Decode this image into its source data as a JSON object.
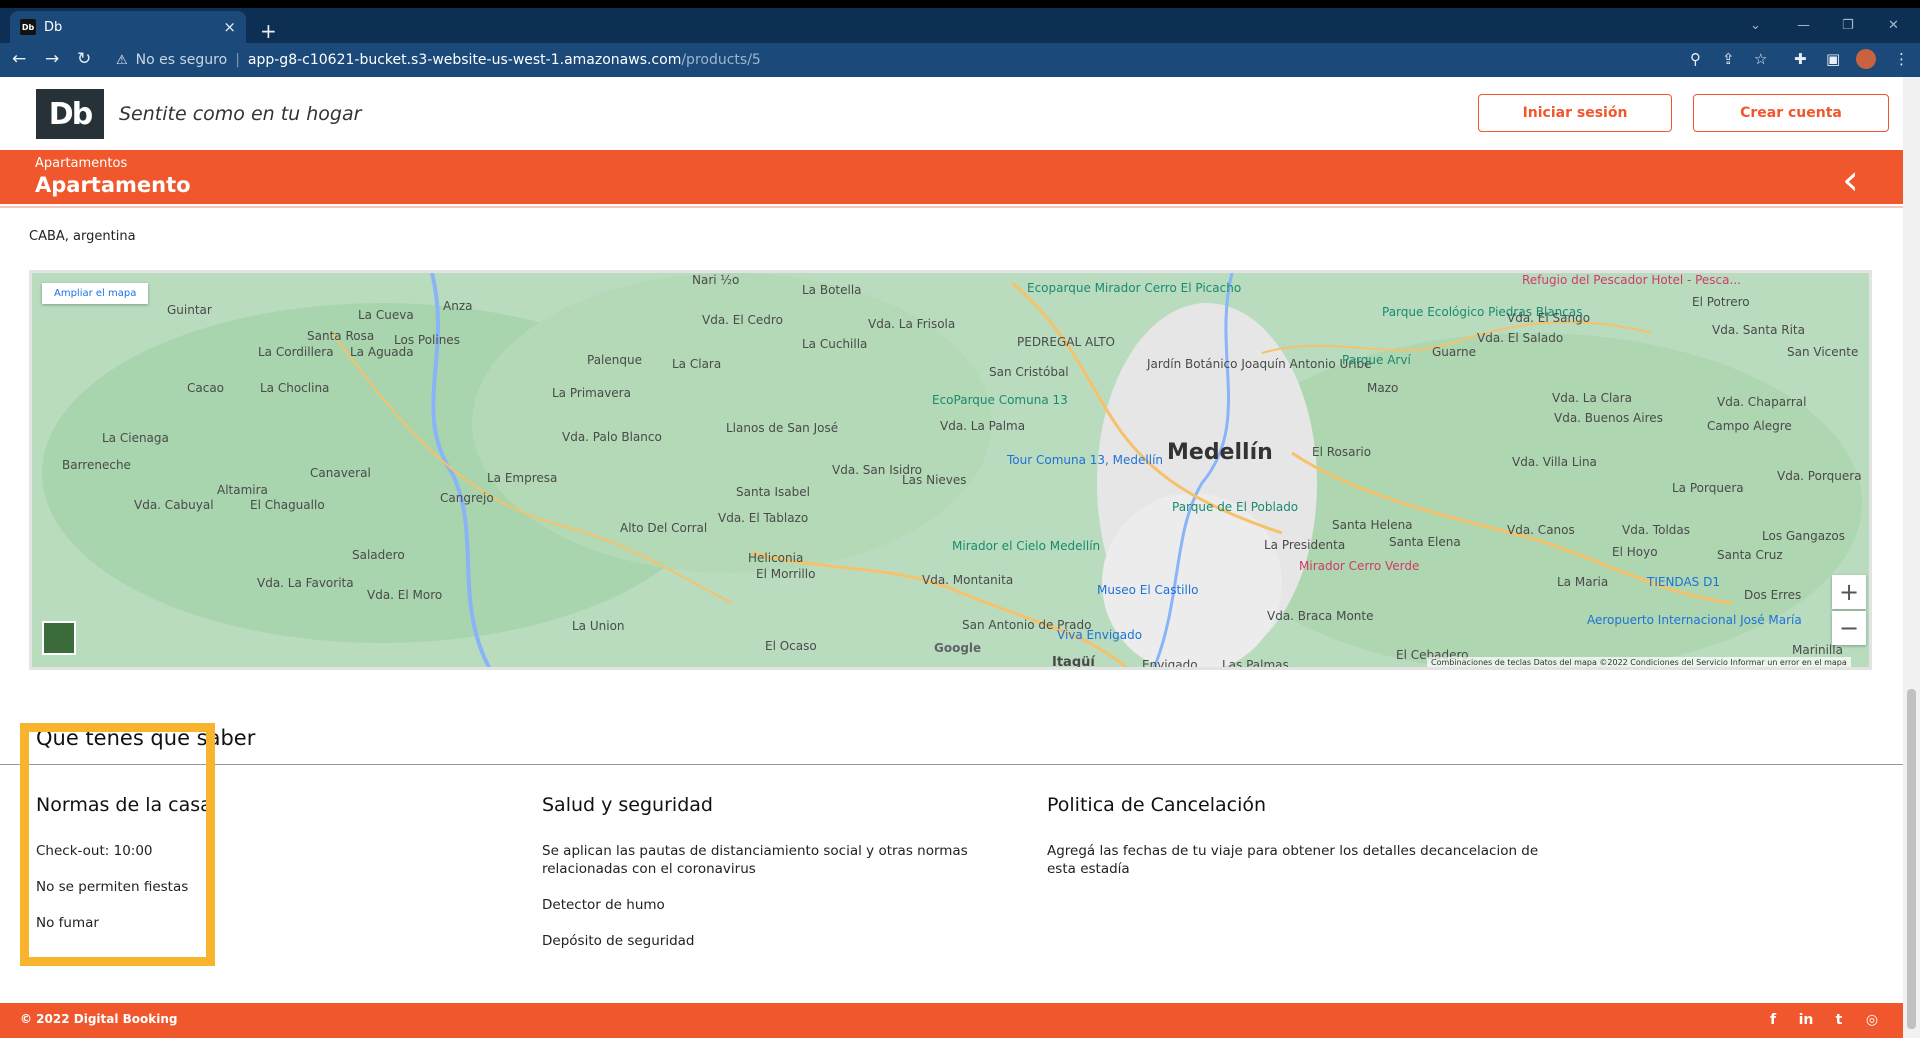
{
  "browser": {
    "tab_title": "Db",
    "tab_favicon": "Db",
    "close_glyph": "×",
    "newtab_glyph": "+",
    "security_label": "No es seguro",
    "url_host": "app-g8-c10621-bucket.s3-website-us-west-1.amazonaws.com",
    "url_path": "/products/5"
  },
  "header": {
    "logo": "Db",
    "tagline": "Sentite como en tu hogar",
    "login_label": "Iniciar sesión",
    "signup_label": "Crear cuenta"
  },
  "product": {
    "category": "Apartamentos",
    "name": "Apartamento",
    "back_glyph": "‹",
    "location": "CABA, argentina"
  },
  "map": {
    "enlarge_label": "Ampliar el mapa",
    "zoom_in": "+",
    "zoom_out": "−",
    "google": "Google",
    "footer": "Combinaciones de teclas   Datos del mapa ©2022   Condiciones del Servicio   Informar un error en el mapa",
    "labels": [
      "Guintar",
      "La Cueva",
      "Anza",
      "Santa Rosa",
      "Los Polines",
      "La Cordillera",
      "La Aguada",
      "Cacao",
      "La Choclina",
      "La Cienaga",
      "Barreneche",
      "Altamira",
      "Vda. Cabuyal",
      "El Chaguallo",
      "Canaveral",
      "Cangrejo",
      "Saladero",
      "Vda. La Favorita",
      "Vda. El Moro",
      "Nari ½o",
      "La Botella",
      "Vda. El Cedro",
      "Vda. La Frisola",
      "La Cuchilla",
      "Palenque",
      "La Clara",
      "La Primavera",
      "Vda. Palo Blanco",
      "Llanos de San José",
      "Santa Isabel",
      "Vda. San Isidro",
      "Las Nieves",
      "La Empresa",
      "Alto Del Corral",
      "Vda. El Tablazo",
      "Heliconia",
      "El Morrillo",
      "La Union",
      "El Ocaso",
      "Vda. Montanita",
      "San Antonio de Prado",
      "Ecoparque Mirador Cerro El Picacho",
      "PEDREGAL ALTO",
      "San Cristóbal",
      "Jardín Botánico Joaquín Antonio Uribe",
      "EcoParque Comuna 13",
      "Vda. La Palma",
      "Tour Comuna 13, Medellín",
      "Medellín",
      "Parque de El Poblado",
      "Mirador el Cielo Medellín",
      "Museo El Castillo",
      "Viva Envigado",
      "Itagüí",
      "Envigado",
      "Las Palmas",
      "Parque Ecológico Piedras Blancas",
      "Vda. El Sango",
      "Vda. El Salado",
      "Guarne",
      "Parque Arví",
      "Mazo",
      "El Rosario",
      "Santa Helena",
      "Santa Elena",
      "La Presidenta",
      "Mirador Cerro Verde",
      "Vda. Braca Monte",
      "El Cebadero",
      "Vda. La Clara",
      "Vda. Buenos Aires",
      "Vda. Villa Lina",
      "Vda. Canos",
      "Vda. Toldas",
      "El Hoyo",
      "La Maria",
      "TIENDAS D1",
      "Aeropuerto Internacional José María",
      "El Potrero",
      "Vda. Santa Rita",
      "San Vicente",
      "Vda. Chaparral",
      "Campo Alegre",
      "Vda. Porquera",
      "La Porquera",
      "Los Gangazos",
      "Santa Cruz",
      "Dos Erres",
      "Marinilla",
      "Refugio del Pescador Hotel - Pesca..."
    ]
  },
  "info": {
    "section_title": "Qué tenés que saber",
    "house_rules": {
      "title": "Normas de la casa",
      "items": [
        "Check-out: 10:00",
        "No se permiten fiestas",
        "No fumar"
      ]
    },
    "health": {
      "title": "Salud y seguridad",
      "items": [
        "Se aplican las pautas de distanciamiento social y otras normas relacionadas con el coronavirus",
        "Detector de humo",
        "Depósito de seguridad"
      ]
    },
    "cancellation": {
      "title": "Politica de Cancelación",
      "items": [
        "Agregá las fechas de tu viaje para obtener los detalles decancelacion de esta estadía"
      ]
    }
  },
  "footer": {
    "copyright": "© 2022 Digital Booking",
    "social": [
      "facebook-icon",
      "linkedin-icon",
      "twitter-icon",
      "instagram-icon"
    ]
  },
  "colors": {
    "brand": "#f0572d",
    "highlight": "#f7b42c",
    "chrome": "#1b4a7a"
  }
}
